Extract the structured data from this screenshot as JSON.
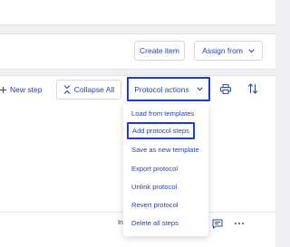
{
  "toolbar_top": {
    "create_item_label": "Create item",
    "assign_from_label": "Assign from"
  },
  "protocol_toolbar": {
    "new_step_label": "New step",
    "collapse_all_label": "Collapse All",
    "protocol_actions_label": "Protocol actions"
  },
  "protocol_actions_menu": {
    "items": [
      "Load from templates",
      "Add protocol steps",
      "Save as new template",
      "Export protocol",
      "Unlink protocol",
      "Revert protocol",
      "Delete all steps"
    ],
    "highlighted_index": 1
  },
  "row_fragment": "In",
  "icons": {
    "new_step": "plus-icon",
    "collapse_all": "collapse-arrows-icon",
    "dropdown": "chevron-down-icon",
    "print": "print-icon",
    "sort": "sort-icon",
    "comment": "comment-icon",
    "more": "more-options-icon"
  },
  "colors": {
    "accent": "#2545a8",
    "highlight_border": "#1a39d6",
    "background": "#eef0f4"
  }
}
